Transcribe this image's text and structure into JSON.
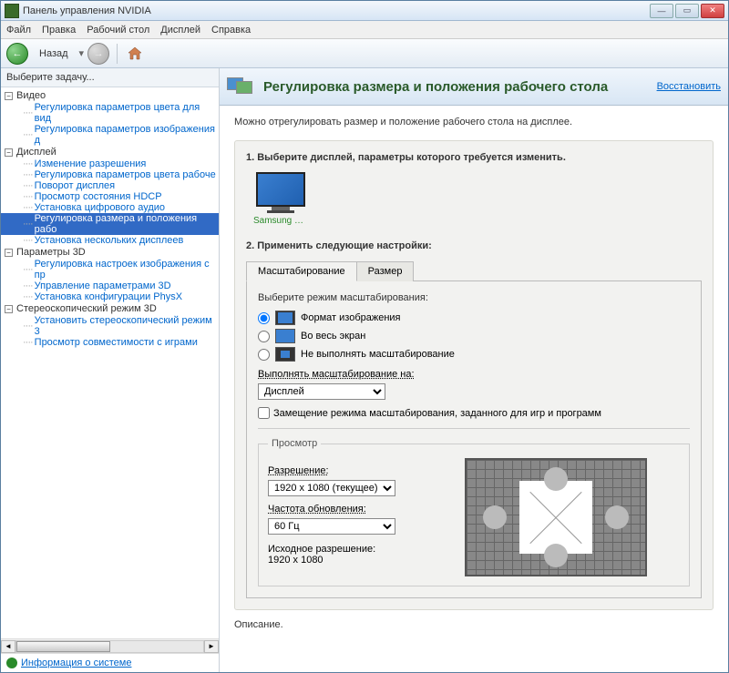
{
  "window": {
    "title": "Панель управления NVIDIA"
  },
  "menu": [
    "Файл",
    "Правка",
    "Рабочий стол",
    "Дисплей",
    "Справка"
  ],
  "navback": "Назад",
  "sidebar": {
    "header": "Выберите задачу...",
    "tree": [
      {
        "cat": "Видео",
        "items": [
          "Регулировка параметров цвета для вид",
          "Регулировка параметров изображения д"
        ]
      },
      {
        "cat": "Дисплей",
        "items": [
          "Изменение разрешения",
          "Регулировка параметров цвета рабоче",
          "Поворот дисплея",
          "Просмотр состояния HDCP",
          "Установка цифрового аудио",
          "Регулировка размера и положения рабо",
          "Установка нескольких дисплеев"
        ],
        "selected": 5
      },
      {
        "cat": "Параметры 3D",
        "items": [
          "Регулировка настроек изображения с пр",
          "Управление параметрами 3D",
          "Установка конфигурации PhysX"
        ]
      },
      {
        "cat": "Стереоскопический режим 3D",
        "items": [
          "Установить стереоскопический режим 3",
          "Просмотр совместимости с играми"
        ]
      }
    ],
    "sysinfo": "Информация о системе"
  },
  "content": {
    "title": "Регулировка размера и положения рабочего стола",
    "restore": "Восстановить",
    "desc": "Можно отрегулировать размер и положение рабочего стола на дисплее.",
    "step1": "1. Выберите дисплей, параметры которого требуется изменить.",
    "monitor_label": "Samsung SMS...",
    "step2": "2. Применить следующие настройки:",
    "tabs": [
      "Масштабирование",
      "Размер"
    ],
    "scaling": {
      "heading": "Выберите режим масштабирования:",
      "opt_aspect": "Формат изображения",
      "opt_full": "Во весь экран",
      "opt_none": "Не выполнять масштабирование",
      "perform_label": "Выполнять масштабирование на:",
      "perform_value": "Дисплей",
      "override": "Замещение режима масштабирования, заданного для игр и программ"
    },
    "preview": {
      "legend": "Просмотр",
      "res_label": "Разрешение:",
      "res_value": "1920 x 1080 (текущее)",
      "refresh_label": "Частота обновления:",
      "refresh_value": "60 Гц",
      "native_label": "Исходное разрешение:",
      "native_value": "1920 x 1080"
    },
    "footer": "Описание."
  }
}
